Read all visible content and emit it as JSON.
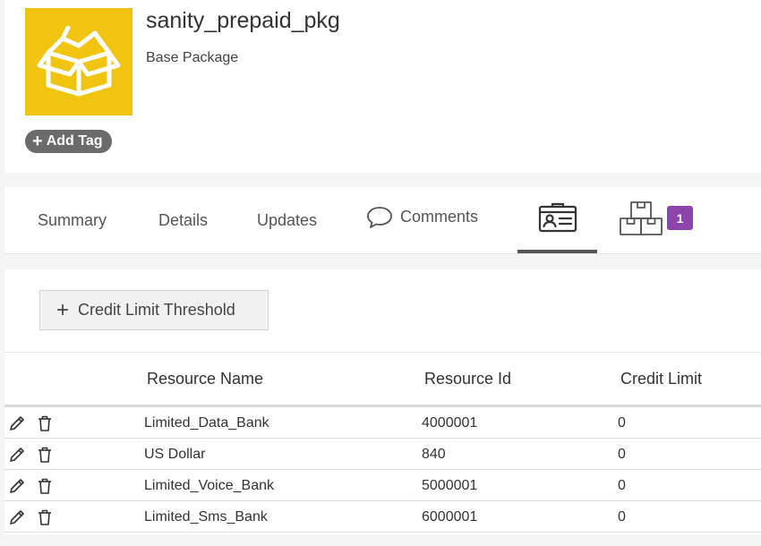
{
  "header": {
    "title": "sanity_prepaid_pkg",
    "subtitle": "Base Package",
    "logo_icon": "open-box-icon",
    "logo_color": "#f1c40f",
    "add_tag_label": "Add Tag"
  },
  "tabs": {
    "summary": "Summary",
    "details": "Details",
    "updates": "Updates",
    "comments": "Comments",
    "contact_icon": "contact-card-icon",
    "packages_icon": "boxes-icon",
    "packages_badge": "1",
    "active": "contact-card",
    "badge_color": "#8e44ad"
  },
  "threshold": {
    "add_label": "Credit Limit Threshold"
  },
  "table": {
    "headers": {
      "name": "Resource Name",
      "id": "Resource Id",
      "limit": "Credit Limit"
    },
    "rows": [
      {
        "name": "Limited_Data_Bank",
        "id": "4000001",
        "limit": "0"
      },
      {
        "name": "US Dollar",
        "id": "840",
        "limit": "0"
      },
      {
        "name": "Limited_Voice_Bank",
        "id": "5000001",
        "limit": "0"
      },
      {
        "name": "Limited_Sms_Bank",
        "id": "6000001",
        "limit": "0"
      }
    ]
  }
}
